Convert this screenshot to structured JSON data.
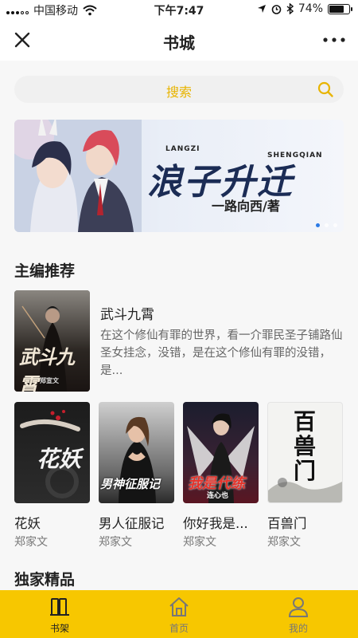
{
  "status_bar": {
    "carrier": "中国移动",
    "time": "下午7:47",
    "battery": "74%",
    "battery_level": 0.74
  },
  "navbar": {
    "title": "书城",
    "close_icon": "close-icon",
    "more_icon": "more-icon"
  },
  "search": {
    "label": "搜索",
    "icon": "search-icon"
  },
  "banner": {
    "title": "浪子升迁",
    "subtitle_left": "LANGZI",
    "subtitle_right": "SHENGQIAN",
    "author_line": "一路向西/著",
    "slide_count": 3,
    "active_slide": 1
  },
  "section1": {
    "title": "主编推荐",
    "featured": {
      "name": "武斗九霄",
      "description": "在这个修仙有罪的世界，看一介罪民圣子铺路仙圣女挂念，没错，是在这个修仙有罪的没错，是...",
      "cover_text": "武斗九霄",
      "cover_author": "郑宣文"
    },
    "books": [
      {
        "name": "花妖",
        "author": "郑家文",
        "cover_text": "花妖"
      },
      {
        "name": "男人征服记",
        "author": "郑家文",
        "cover_text": "男神征服记"
      },
      {
        "name": "你好我是...",
        "author": "郑家文",
        "cover_text": "我是代练",
        "cover_author": "连心也"
      },
      {
        "name": "百兽门",
        "author": "郑家文",
        "cover_text": "百兽门"
      }
    ]
  },
  "section2": {
    "title": "独家精品"
  },
  "tabbar": {
    "tabs": [
      {
        "label": "书架",
        "icon": "bookshelf-icon",
        "active": true
      },
      {
        "label": "首页",
        "icon": "home-icon",
        "active": false
      },
      {
        "label": "我的",
        "icon": "profile-icon",
        "active": false
      }
    ]
  },
  "colors": {
    "accent": "#f7c700",
    "search_text": "#e8b400",
    "indicator_active": "#2c7be5"
  }
}
